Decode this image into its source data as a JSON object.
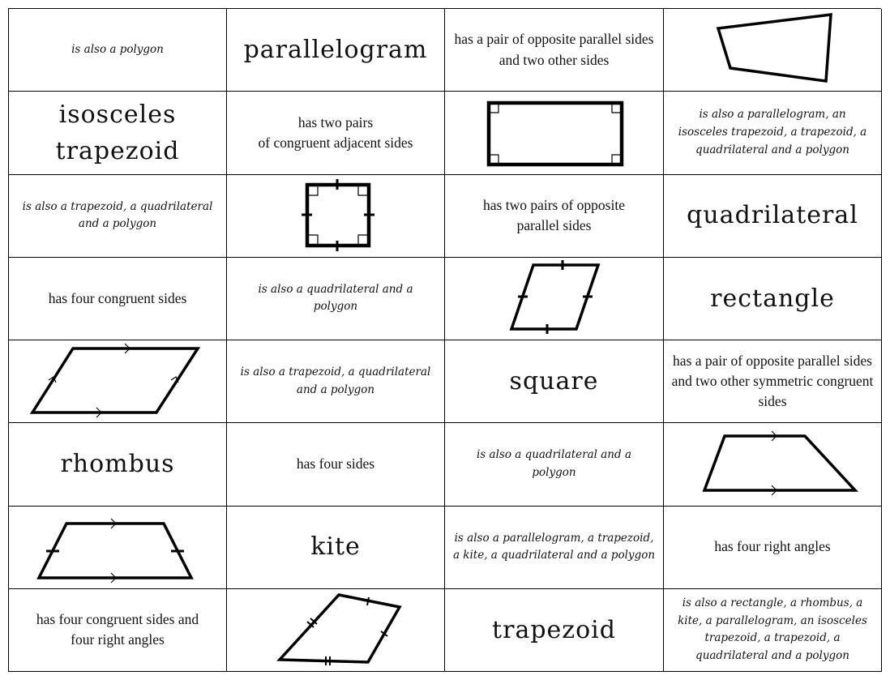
{
  "cards": [
    {
      "kind": "also",
      "text": "is also a polygon"
    },
    {
      "kind": "term",
      "text": "parallelogram"
    },
    {
      "kind": "desc",
      "text": "has a pair of opposite parallel sides and two other sides"
    },
    {
      "kind": "shape",
      "shape": "quadrilateral-icon"
    },
    {
      "kind": "term",
      "text": "isosceles trapezoid"
    },
    {
      "kind": "desc",
      "text": "has two pairs\nof congruent adjacent sides"
    },
    {
      "kind": "shape",
      "shape": "rectangle-icon"
    },
    {
      "kind": "also",
      "text": "is also a parallelogram, an isosceles trapezoid, a trapezoid, a quadrilateral and a polygon"
    },
    {
      "kind": "also",
      "text": "is also a trapezoid, a quadrilateral and a polygon"
    },
    {
      "kind": "shape",
      "shape": "square-icon"
    },
    {
      "kind": "desc",
      "text": "has two pairs of opposite parallel sides"
    },
    {
      "kind": "term",
      "text": "quadrilateral"
    },
    {
      "kind": "desc",
      "text": "has four congruent sides"
    },
    {
      "kind": "also",
      "text": "is also a quadrilateral and a polygon"
    },
    {
      "kind": "shape",
      "shape": "rhombus-icon"
    },
    {
      "kind": "term",
      "text": "rectangle"
    },
    {
      "kind": "shape",
      "shape": "parallelogram-icon"
    },
    {
      "kind": "also",
      "text": "is also a trapezoid, a quadrilateral and a polygon"
    },
    {
      "kind": "term",
      "text": "square"
    },
    {
      "kind": "desc",
      "text": "has a pair of opposite parallel sides and two other symmetric congruent sides"
    },
    {
      "kind": "term",
      "text": "rhombus"
    },
    {
      "kind": "desc",
      "text": "has four sides"
    },
    {
      "kind": "also",
      "text": "is also a quadrilateral and a polygon"
    },
    {
      "kind": "shape",
      "shape": "trapezoid-icon"
    },
    {
      "kind": "shape",
      "shape": "isosceles-trapezoid-icon"
    },
    {
      "kind": "term",
      "text": "kite"
    },
    {
      "kind": "also",
      "text": "is also a parallelogram, a trapezoid, a kite, a quadrilateral and a polygon"
    },
    {
      "kind": "desc",
      "text": "has four right angles"
    },
    {
      "kind": "desc",
      "text": "has four congruent sides and four right angles"
    },
    {
      "kind": "shape",
      "shape": "kite-icon"
    },
    {
      "kind": "term",
      "text": "trapezoid"
    },
    {
      "kind": "also",
      "text": "is also a rectangle, a rhombus, a kite, a parallelogram, an isosceles trapezoid, a trapezoid, a quadrilateral and a polygon"
    }
  ]
}
